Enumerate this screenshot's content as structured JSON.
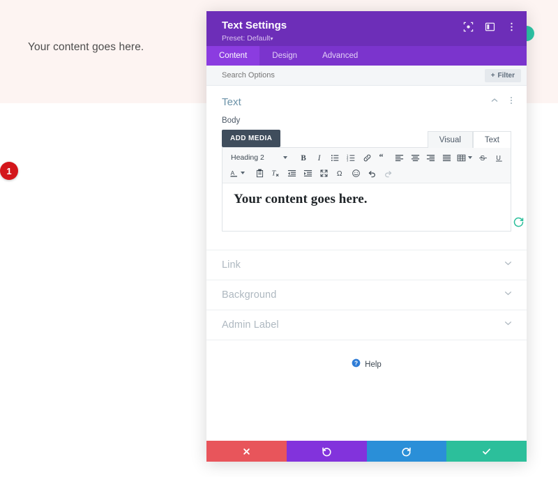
{
  "page": {
    "content_text": "Your content goes here.",
    "section_bg": "#fdf4f2",
    "bubble_color": "#2ec4a6"
  },
  "panel": {
    "title": "Text Settings",
    "preset_label": "Preset: Default",
    "preset_caret": "▾",
    "header_color": "#6d2eb8",
    "header_icons": [
      {
        "name": "focus-icon"
      },
      {
        "name": "layout-columns-icon"
      },
      {
        "name": "more-vertical-icon"
      }
    ],
    "tabs": [
      {
        "label": "Content",
        "active": true
      },
      {
        "label": "Design",
        "active": false
      },
      {
        "label": "Advanced",
        "active": false
      }
    ],
    "search": {
      "placeholder": "Search Options",
      "value": ""
    },
    "filter": {
      "label": "Filter",
      "plus": "+"
    },
    "toggle": {
      "title": "Text",
      "collapse_icon": "chevron-up-icon",
      "menu_icon": "more-vertical-icon"
    },
    "body_field": {
      "label": "Body",
      "add_media_label": "ADD MEDIA",
      "editor_tabs": [
        {
          "label": "Visual",
          "active": true
        },
        {
          "label": "Text",
          "active": false
        }
      ],
      "format_select": "Heading 2",
      "content": "Your content goes here.",
      "toolbar_row1": [
        "bold-icon",
        "italic-icon",
        "bulleted-list-icon",
        "numbered-list-icon",
        "link-icon",
        "blockquote-icon",
        "align-left-icon",
        "align-center-icon",
        "align-right-icon",
        "align-justify-icon",
        "table-icon",
        "strikethrough-icon",
        "underline-icon"
      ],
      "toolbar_row2": [
        "text-color-icon",
        "paste-as-text-icon",
        "clear-formatting-icon",
        "decrease-indent-icon",
        "increase-indent-icon",
        "fullscreen-icon",
        "special-character-icon",
        "emoji-icon",
        "undo-icon",
        "redo-icon"
      ],
      "reset_icon": "reset-circle-icon",
      "reset_color": "#2cbf9b"
    },
    "badge": {
      "number": "1",
      "color": "#d3161b"
    },
    "sections": [
      {
        "label": "Link"
      },
      {
        "label": "Background"
      },
      {
        "label": "Admin Label"
      }
    ],
    "help": {
      "label": "Help",
      "icon": "help-circle-icon",
      "icon_color": "#2e7cd6"
    },
    "footer_buttons": [
      {
        "name": "cancel-button",
        "icon": "close-icon",
        "color": "#e8555b"
      },
      {
        "name": "undo-button",
        "icon": "undo-icon",
        "color": "#8233dc"
      },
      {
        "name": "redo-button",
        "icon": "redo-icon",
        "color": "#2a8fd8"
      },
      {
        "name": "save-button",
        "icon": "check-icon",
        "color": "#2cbf9b"
      }
    ]
  }
}
